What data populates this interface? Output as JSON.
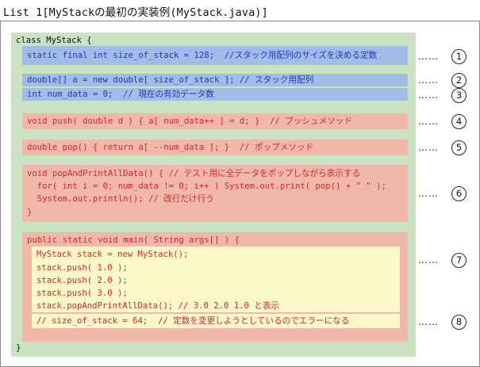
{
  "caption": "List 1[MyStackの最初の実装例(MyStack.java)]",
  "code": {
    "class_open": "class MyStack {",
    "line_static": "static final int size_of_stack = 128;  //スタック用配列のサイズを決める定数",
    "line_array": "double[] a = new double[ size_of_stack ]; // スタック用配列",
    "line_num": "int num_data = 0;  // 現在の有効データ数",
    "line_push": "void push( double d ) { a[ num_data++ ] = d; }  // プッシュメソッド",
    "line_pop": "double pop() { return a[ --num_data ]; }  // ポップメソッド",
    "line_ppa1": "void popAndPrintAllData() { // テスト用に全データをポップしながら表示する",
    "line_ppa2": "  for( int i = 0; num_data != 0; i++ ) System.out.print( pop() + \" \" );",
    "line_ppa3": "  System.out.println(); // 改行だけ行う",
    "line_ppa4": "}",
    "line_main": "public static void main( String args[] ) {",
    "line_m1": "MyStack stack = new MyStack();",
    "line_m2": "stack.push( 1.0 );",
    "line_m3": "stack.push( 2.0 );",
    "line_m4": "stack.push( 3.0 );",
    "line_m5": "stack.popAndPrintAllData(); // 3.0 2.0 1.0 と表示",
    "line_m6": "// size_of_stack = 64;  // 定数を変更しようとしているのでエラーになる",
    "class_close": "}"
  },
  "markers": {
    "dots": "……",
    "m1": "1",
    "m2": "2",
    "m3": "3",
    "m4": "4",
    "m5": "5",
    "m6": "6",
    "m7": "7",
    "m8": "8"
  },
  "colors": {
    "outer_block": "#c9e3c3",
    "blue_block": "#9fbde6",
    "pink_block": "#f1b7a8",
    "yellow_block": "#fdf8c9",
    "blue_text": "#1f38b8",
    "red_text": "#cc2b2b"
  }
}
